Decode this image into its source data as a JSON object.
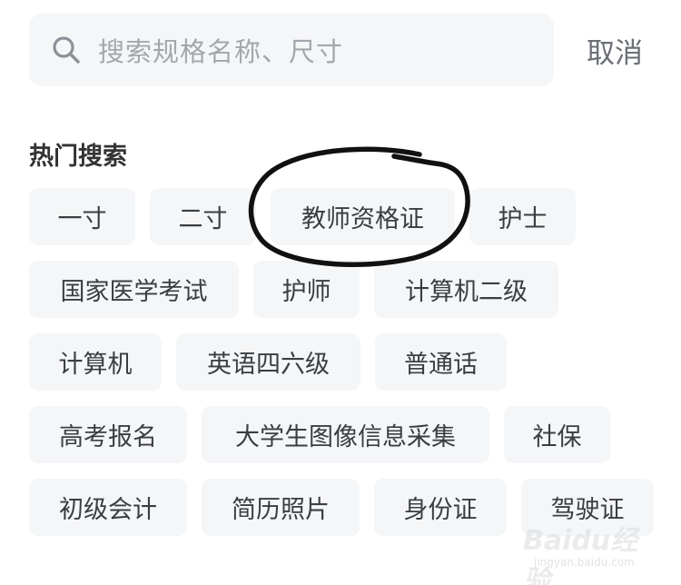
{
  "search": {
    "placeholder": "搜索规格名称、尺寸",
    "cancel_label": "取消"
  },
  "hot_search": {
    "title": "热门搜索",
    "tags": [
      "一寸",
      "二寸",
      "教师资格证",
      "护士",
      "国家医学考试",
      "护师",
      "计算机二级",
      "计算机",
      "英语四六级",
      "普通话",
      "高考报名",
      "大学生图像信息采集",
      "社保",
      "初级会计",
      "简历照片",
      "身份证",
      "驾驶证"
    ]
  },
  "annotation": {
    "circled_tag": "教师资格证",
    "stroke_color": "#111111"
  },
  "watermark": {
    "brand": "Baidu经验",
    "url": "jingyan.baidu.com"
  },
  "colors": {
    "tag_background": "#f5f6f8",
    "tag_text": "#3a3d42",
    "placeholder_text": "#a3a7ad",
    "cancel_text": "#6b6f76"
  }
}
